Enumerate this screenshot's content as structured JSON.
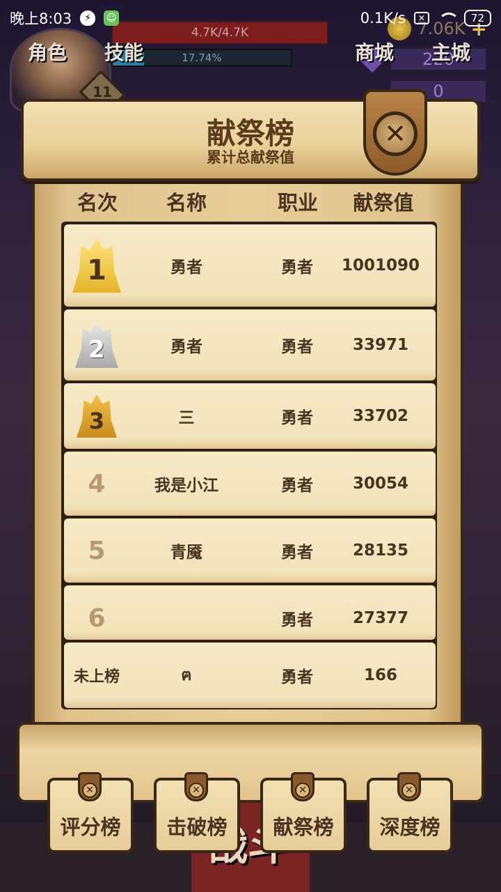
{
  "status_bar": {
    "time": "晚上8:03",
    "net_speed": "0.1K/s",
    "battery": "72",
    "icons": [
      "shield-bolt-icon",
      "android-icon",
      "x-box-icon",
      "wifi-icon",
      "battery-icon"
    ]
  },
  "hud": {
    "hp": "4.7K/4.7K",
    "exp": "17.74%",
    "exp_fraction": 0.1774,
    "level": "11",
    "gold": "7.06K",
    "gems": "220",
    "keys": "0",
    "icons": [
      "avatar",
      "coin-icon",
      "gem-icon",
      "key-icon",
      "plus-icon"
    ]
  },
  "panel": {
    "title": "献祭榜",
    "subtitle": "累计总献祭值",
    "close_icon": "close-icon"
  },
  "table": {
    "headers": [
      "名次",
      "名称",
      "职业",
      "献祭值"
    ],
    "rows": [
      {
        "rank": "1",
        "name": "勇者",
        "class": "勇者",
        "value": "1001090",
        "medal": "gold"
      },
      {
        "rank": "2",
        "name": "勇者",
        "class": "勇者",
        "value": "33971",
        "medal": "silver"
      },
      {
        "rank": "3",
        "name": "三",
        "class": "勇者",
        "value": "33702",
        "medal": "bronze"
      },
      {
        "rank": "4",
        "name": "我是小江",
        "class": "勇者",
        "value": "30054",
        "medal": ""
      },
      {
        "rank": "5",
        "name": "青魇",
        "class": "勇者",
        "value": "28135",
        "medal": ""
      },
      {
        "rank": "6",
        "name": "",
        "class": "勇者",
        "value": "27377",
        "medal": ""
      }
    ],
    "self_row": {
      "rank": "未上榜",
      "name": "ฅ",
      "class": "勇者",
      "value": "166"
    }
  },
  "tabs": [
    "评分榜",
    "击破榜",
    "献祭榜",
    "深度榜"
  ],
  "bottom_nav": [
    "角色",
    "技能",
    "战斗",
    "商城",
    "主城"
  ],
  "colors": {
    "parchment": "#f3e3ba",
    "ink": "#4a3320",
    "gold": "#e5b52a",
    "silver": "#a9a9a9",
    "bronze": "#c98d1c",
    "hp_red": "#7d1d1d",
    "exp_blue": "#2b7fa0"
  }
}
